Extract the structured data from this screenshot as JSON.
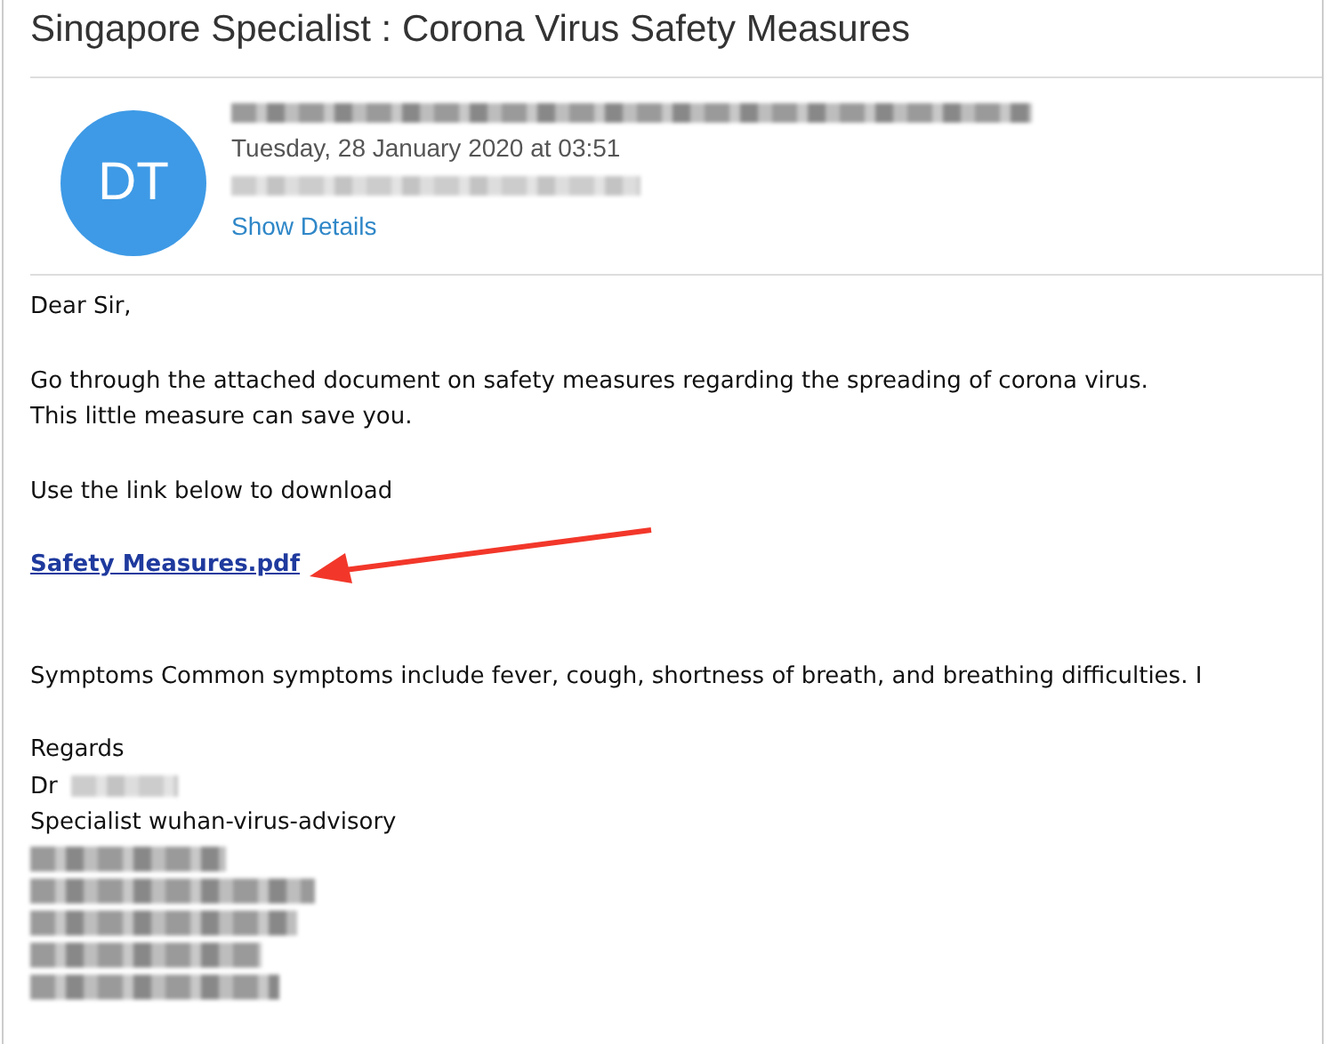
{
  "subject": "Singapore Specialist  : Corona Virus Safety Measures",
  "header": {
    "avatar_initials": "DT",
    "sender_redacted": true,
    "date": "Tuesday, 28 January 2020 at 03:51",
    "recipient_redacted": true,
    "details_link": "Show Details"
  },
  "body": [
    {
      "kind": "text",
      "text": "Dear Sir,"
    },
    {
      "kind": "gap"
    },
    {
      "kind": "text",
      "text": "Go through the attached document on safety measures regarding the spreading of corona virus."
    },
    {
      "kind": "text",
      "text": "This little measure can save you."
    },
    {
      "kind": "gap"
    },
    {
      "kind": "text",
      "text": "Use the link below to download"
    },
    {
      "kind": "gap"
    },
    {
      "kind": "link",
      "text": "Safety Measures.pdf",
      "annotated": true
    },
    {
      "kind": "gap"
    },
    {
      "kind": "gap"
    },
    {
      "kind": "text",
      "text": "Symptoms  Common symptoms include fever, cough, shortness of breath, and breathing difficulties. I"
    },
    {
      "kind": "gap"
    },
    {
      "kind": "text",
      "text": "Regards"
    },
    {
      "kind": "text",
      "text": "Dr",
      "redacted_name": true
    },
    {
      "kind": "text",
      "text": "Specialist wuhan-virus-advisory"
    },
    {
      "kind": "redacted"
    },
    {
      "kind": "redacted"
    },
    {
      "kind": "redacted"
    },
    {
      "kind": "redacted"
    },
    {
      "kind": "redacted"
    }
  ]
}
